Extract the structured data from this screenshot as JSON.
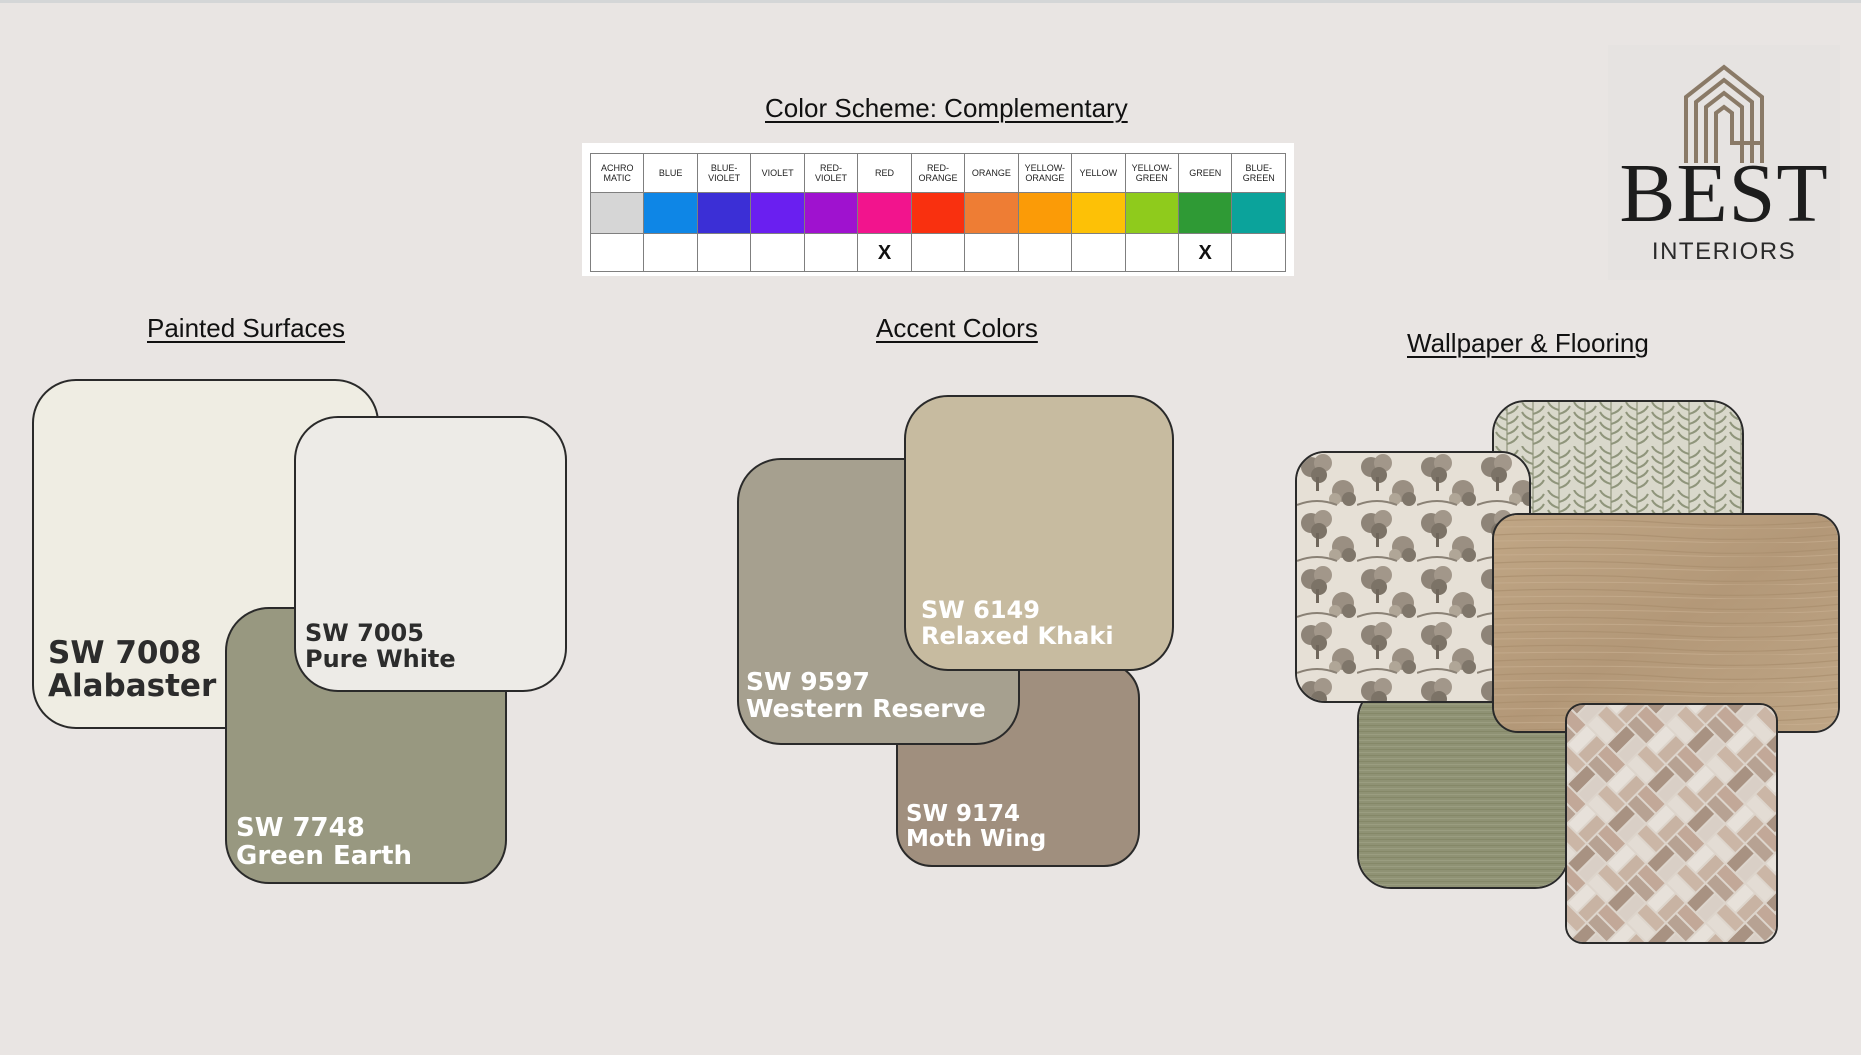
{
  "slide": {
    "scheme_title": "Color Scheme: Complementary",
    "sections": {
      "painted": "Painted Surfaces",
      "accent": "Accent Colors",
      "wallpaper": "Wallpaper & Flooring"
    }
  },
  "color_wheel": {
    "columns": [
      {
        "name": "ACHRO MATIC",
        "color": "#d6d6d6",
        "mark": ""
      },
      {
        "name": "BLUE",
        "color": "#0e86e6",
        "mark": ""
      },
      {
        "name": "BLUE-VIOLET",
        "color": "#3b2fd6",
        "mark": ""
      },
      {
        "name": "VIOLET",
        "color": "#6a1ff0",
        "mark": ""
      },
      {
        "name": "RED-VIOLET",
        "color": "#9f12cf",
        "mark": ""
      },
      {
        "name": "RED",
        "color": "#f2148d",
        "mark": "X"
      },
      {
        "name": "RED-ORANGE",
        "color": "#f9300f",
        "mark": ""
      },
      {
        "name": "ORANGE",
        "color": "#ee7d34",
        "mark": ""
      },
      {
        "name": "YELLOW-ORANGE",
        "color": "#fb9b07",
        "mark": ""
      },
      {
        "name": "YELLOW",
        "color": "#fdc106",
        "mark": ""
      },
      {
        "name": "YELLOW-GREEN",
        "color": "#8fcb1c",
        "mark": ""
      },
      {
        "name": "GREEN",
        "color": "#2f9a35",
        "mark": "X"
      },
      {
        "name": "BLUE-GREEN",
        "color": "#0ba39b",
        "mark": ""
      }
    ]
  },
  "painted_swatches": [
    {
      "code": "SW 7008",
      "name": "Alabaster",
      "color": "#efede3",
      "text_color": "#2c2c2c"
    },
    {
      "code": "SW 7748",
      "name": "Green Earth",
      "color": "#989880",
      "text_color": "#ffffff"
    },
    {
      "code": "SW 7005",
      "name": "Pure White",
      "color": "#edebe7",
      "text_color": "#2c2c2c"
    }
  ],
  "accent_swatches": [
    {
      "code": "SW 9174",
      "name": "Moth Wing",
      "color": "#a08f7e",
      "text_color": "#ffffff"
    },
    {
      "code": "SW 9597",
      "name": "Western Reserve",
      "color": "#a6a08f",
      "text_color": "#ffffff"
    },
    {
      "code": "SW 6149",
      "name": "Relaxed Khaki",
      "color": "#c7bba0",
      "text_color": "#ffffff"
    }
  ],
  "material_samples": [
    {
      "name": "leaf-pattern-wallpaper",
      "color": "#d9d8cb"
    },
    {
      "name": "toile-tree-wallpaper",
      "color": "#c4bcb1"
    },
    {
      "name": "grasscloth-green",
      "color": "#8f9274"
    },
    {
      "name": "oak-wood-flooring",
      "color": "#b89f7f"
    },
    {
      "name": "herringbone-brick-tile",
      "color": "#c9bdb3"
    }
  ],
  "logo": {
    "brand": "BEST",
    "tagline": "INTERIORS",
    "color": "#8a7a67"
  }
}
